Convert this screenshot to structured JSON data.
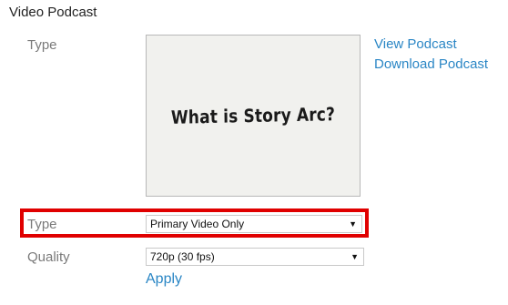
{
  "section": {
    "title": "Video Podcast"
  },
  "preview": {
    "label": "Type",
    "thumbnail_text": "What is Story Arc?"
  },
  "links": {
    "view": "View Podcast",
    "download": "Download Podcast"
  },
  "type_select": {
    "label": "Type",
    "value": "Primary Video Only"
  },
  "quality_select": {
    "label": "Quality",
    "value": "720p (30 fps)"
  },
  "apply_label": "Apply",
  "colors": {
    "link": "#2a86c5",
    "highlight": "#e00000",
    "label": "#7a7a7a"
  },
  "icons": {
    "dropdown": "caret-down-icon"
  }
}
